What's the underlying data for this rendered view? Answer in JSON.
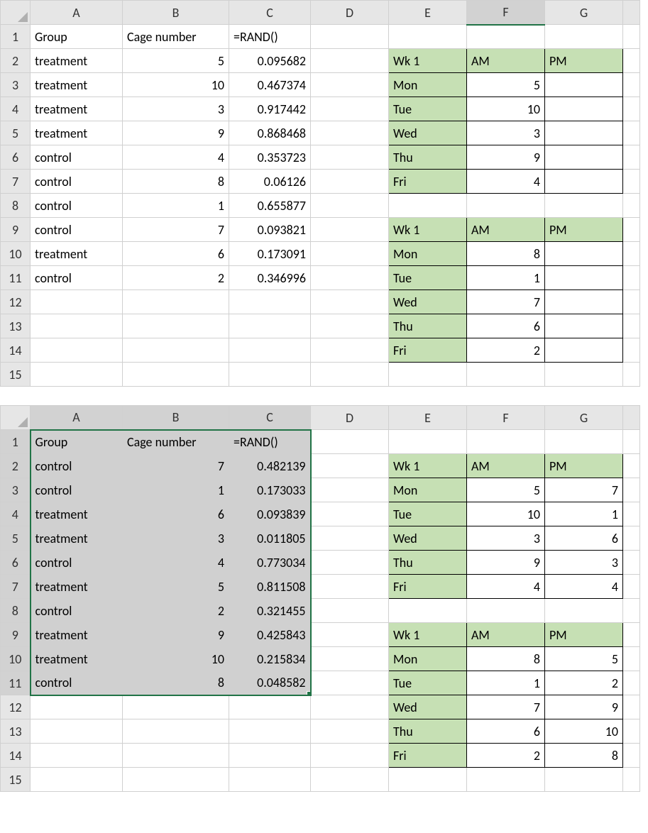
{
  "columns": [
    "A",
    "B",
    "C",
    "D",
    "E",
    "F",
    "G"
  ],
  "rowLabels": [
    "1",
    "2",
    "3",
    "4",
    "5",
    "6",
    "7",
    "8",
    "9",
    "10",
    "11",
    "12",
    "13",
    "14",
    "15"
  ],
  "sheet1": {
    "activeCol": "F",
    "headers": {
      "A": "Group",
      "B": "Cage number",
      "C": "=RAND()"
    },
    "main": [
      {
        "A": "treatment",
        "B": "5",
        "C": "0.095682"
      },
      {
        "A": "treatment",
        "B": "10",
        "C": "0.467374"
      },
      {
        "A": "treatment",
        "B": "3",
        "C": "0.917442"
      },
      {
        "A": "treatment",
        "B": "9",
        "C": "0.868468"
      },
      {
        "A": "control",
        "B": "4",
        "C": "0.353723"
      },
      {
        "A": "control",
        "B": "8",
        "C": "0.06126"
      },
      {
        "A": "control",
        "B": "1",
        "C": "0.655877"
      },
      {
        "A": "control",
        "B": "7",
        "C": "0.093821"
      },
      {
        "A": "treatment",
        "B": "6",
        "C": "0.173091"
      },
      {
        "A": "control",
        "B": "2",
        "C": "0.346996"
      }
    ],
    "block1": {
      "header": {
        "E": "Wk 1",
        "F": "AM",
        "G": "PM"
      },
      "rows": [
        {
          "E": "Mon",
          "F": "5",
          "G": ""
        },
        {
          "E": "Tue",
          "F": "10",
          "G": ""
        },
        {
          "E": "Wed",
          "F": "3",
          "G": ""
        },
        {
          "E": "Thu",
          "F": "9",
          "G": ""
        },
        {
          "E": "Fri",
          "F": "4",
          "G": ""
        }
      ]
    },
    "block2": {
      "header": {
        "E": "Wk 1",
        "F": "AM",
        "G": "PM"
      },
      "rows": [
        {
          "E": "Mon",
          "F": "8",
          "G": ""
        },
        {
          "E": "Tue",
          "F": "1",
          "G": ""
        },
        {
          "E": "Wed",
          "F": "7",
          "G": ""
        },
        {
          "E": "Thu",
          "F": "6",
          "G": ""
        },
        {
          "E": "Fri",
          "F": "2",
          "G": ""
        }
      ]
    }
  },
  "sheet2": {
    "selection": {
      "rows": [
        1,
        11
      ],
      "cols": [
        "A",
        "C"
      ]
    },
    "headers": {
      "A": "Group",
      "B": "Cage number",
      "C": "=RAND()"
    },
    "main": [
      {
        "A": "control",
        "B": "7",
        "C": "0.482139"
      },
      {
        "A": "control",
        "B": "1",
        "C": "0.173033"
      },
      {
        "A": "treatment",
        "B": "6",
        "C": "0.093839"
      },
      {
        "A": "treatment",
        "B": "3",
        "C": "0.011805"
      },
      {
        "A": "control",
        "B": "4",
        "C": "0.773034"
      },
      {
        "A": "treatment",
        "B": "5",
        "C": "0.811508"
      },
      {
        "A": "control",
        "B": "2",
        "C": "0.321455"
      },
      {
        "A": "treatment",
        "B": "9",
        "C": "0.425843"
      },
      {
        "A": "treatment",
        "B": "10",
        "C": "0.215834"
      },
      {
        "A": "control",
        "B": "8",
        "C": "0.048582"
      }
    ],
    "block1": {
      "header": {
        "E": "Wk 1",
        "F": "AM",
        "G": "PM"
      },
      "rows": [
        {
          "E": "Mon",
          "F": "5",
          "G": "7"
        },
        {
          "E": "Tue",
          "F": "10",
          "G": "1"
        },
        {
          "E": "Wed",
          "F": "3",
          "G": "6"
        },
        {
          "E": "Thu",
          "F": "9",
          "G": "3"
        },
        {
          "E": "Fri",
          "F": "4",
          "G": "4"
        }
      ]
    },
    "block2": {
      "header": {
        "E": "Wk 1",
        "F": "AM",
        "G": "PM"
      },
      "rows": [
        {
          "E": "Mon",
          "F": "8",
          "G": "5"
        },
        {
          "E": "Tue",
          "F": "1",
          "G": "2"
        },
        {
          "E": "Wed",
          "F": "7",
          "G": "9"
        },
        {
          "E": "Thu",
          "F": "6",
          "G": "10"
        },
        {
          "E": "Fri",
          "F": "2",
          "G": "8"
        }
      ]
    }
  }
}
